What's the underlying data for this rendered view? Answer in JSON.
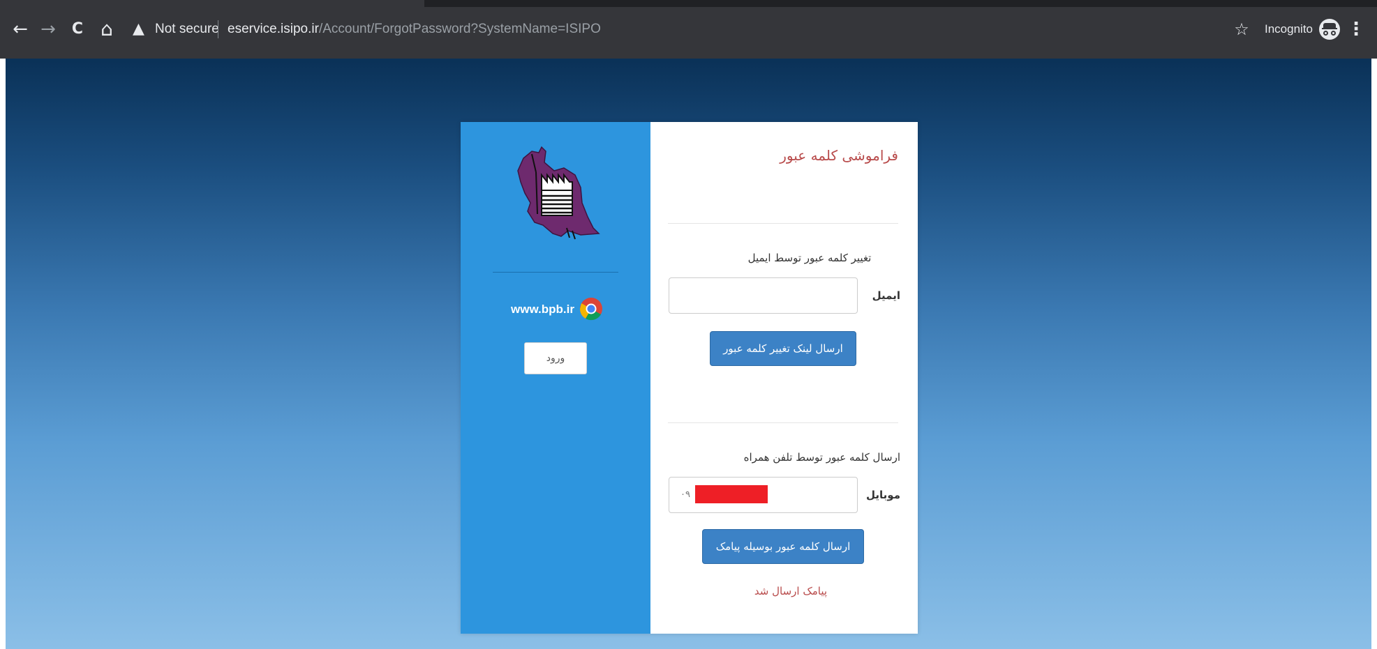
{
  "browser": {
    "back_icon": "←",
    "forward_icon": "→",
    "reload_icon": "C",
    "home_icon": "⌂",
    "security_label": "Not secure",
    "url_host": "eservice.isipo.ir",
    "url_path": "/Account/ForgotPassword?SystemName=ISIPO",
    "incognito_label": "Incognito",
    "star_icon": "☆",
    "menu_icon": "⋮"
  },
  "sidebar": {
    "site_link": "www.bpb.ir",
    "login_label": "ورود"
  },
  "form": {
    "title": "فراموشی کلمه عبور",
    "email_section_heading": "تغییر کلمه عبور توسط ایمیل",
    "email_label": "ایمیل",
    "email_value": "",
    "email_submit_label": "ارسال لینک تغییر کلمه عبور",
    "mobile_section_heading": "ارسال کلمه عبور توسط تلفن همراه",
    "mobile_label": "موبایل",
    "mobile_value_prefix": "۰۹",
    "mobile_submit_label": "ارسال کلمه عبور بوسیله پیامک",
    "sms_status": "پیامک ارسال شد"
  },
  "colors": {
    "chrome_bg": "#35363a",
    "page_gradient_top": "#0a3157",
    "page_gradient_bottom": "#8bbfe7",
    "sidebar_bg": "#2d95de",
    "primary_button": "#3c82c6",
    "title_red": "#b84a4a",
    "redaction_red": "#ee1f26",
    "logo_purple": "#6e2a6e"
  }
}
